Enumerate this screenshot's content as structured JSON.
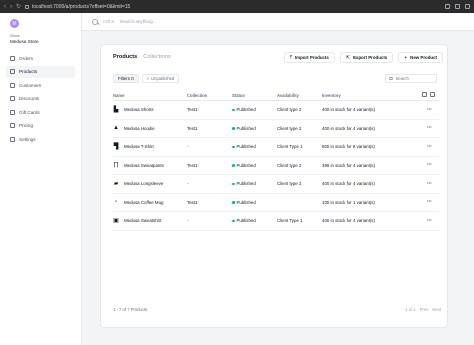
{
  "browser": {
    "url": "localhost:7000/a/products?offset=0&limit=15"
  },
  "store": {
    "label": "Store",
    "name": "Medusa Store",
    "initial": "M"
  },
  "sidebar": {
    "items": [
      {
        "label": "Orders",
        "active": false
      },
      {
        "label": "Products",
        "active": true
      },
      {
        "label": "Customers",
        "active": false
      },
      {
        "label": "Discounts",
        "active": false
      },
      {
        "label": "Gift Cards",
        "active": false
      },
      {
        "label": "Pricing",
        "active": false
      },
      {
        "label": "Settings",
        "active": false
      }
    ]
  },
  "topbar": {
    "shortcut": "Ctrl K",
    "search_placeholder": "Search anything..."
  },
  "page": {
    "tab_products": "Products",
    "tab_collections": "Collections",
    "import_label": "Import Products",
    "export_label": "Export Products",
    "new_label": "New Product"
  },
  "filters": {
    "label": "Filters",
    "count": "0",
    "chip": "Unpublished",
    "search_placeholder": "Search"
  },
  "table": {
    "headers": [
      "Name",
      "Collection",
      "Status",
      "Availability",
      "Inventory"
    ],
    "rows": [
      {
        "name": "Medusa Shorts",
        "icon": "shorts-icon",
        "glyph": "▙",
        "collection": "Test1",
        "status": "Published",
        "availability": "Client type 2",
        "inventory": "400 in stock for 4 variant(s)"
      },
      {
        "name": "Medusa Hoodie",
        "icon": "hoodie-icon",
        "glyph": "▲",
        "collection": "Test1",
        "status": "Published",
        "availability": "Client type 2",
        "inventory": "400 in stock for 4 variant(s)"
      },
      {
        "name": "Medusa T-Shirt",
        "icon": "tshirt-icon",
        "glyph": "▜",
        "collection": "-",
        "status": "Published",
        "availability": "Client Type 1",
        "inventory": "800 in stock for 8 variant(s)"
      },
      {
        "name": "Medusa Sweatpants",
        "icon": "sweatpants-icon",
        "glyph": "∏",
        "collection": "Test1",
        "status": "Published",
        "availability": "Client type 2",
        "inventory": "399 in stock for 4 variant(s)"
      },
      {
        "name": "Medusa Longsleeve",
        "icon": "longsleeve-icon",
        "glyph": "▰",
        "collection": "-",
        "status": "Published",
        "availability": "Client type 2",
        "inventory": "400 in stock for 4 variant(s)"
      },
      {
        "name": "Medusa Coffee Mug",
        "icon": "mug-icon",
        "glyph": "▫",
        "collection": "Test1",
        "status": "Published",
        "availability": "",
        "inventory": "100 in stock for 1 variant(s)"
      },
      {
        "name": "Medusa Sweatshirt",
        "icon": "sweatshirt-icon",
        "glyph": "▣",
        "collection": "-",
        "status": "Published",
        "availability": "Client Type 1",
        "inventory": "400 in stock for 4 variant(s)"
      }
    ]
  },
  "pagination": {
    "summary": "1 - 7 of 7 Products",
    "page": "1 of 1",
    "prev": "Prev",
    "next": "Next"
  },
  "colors": {
    "published": "#10b981",
    "accent": "#a78bfa"
  }
}
